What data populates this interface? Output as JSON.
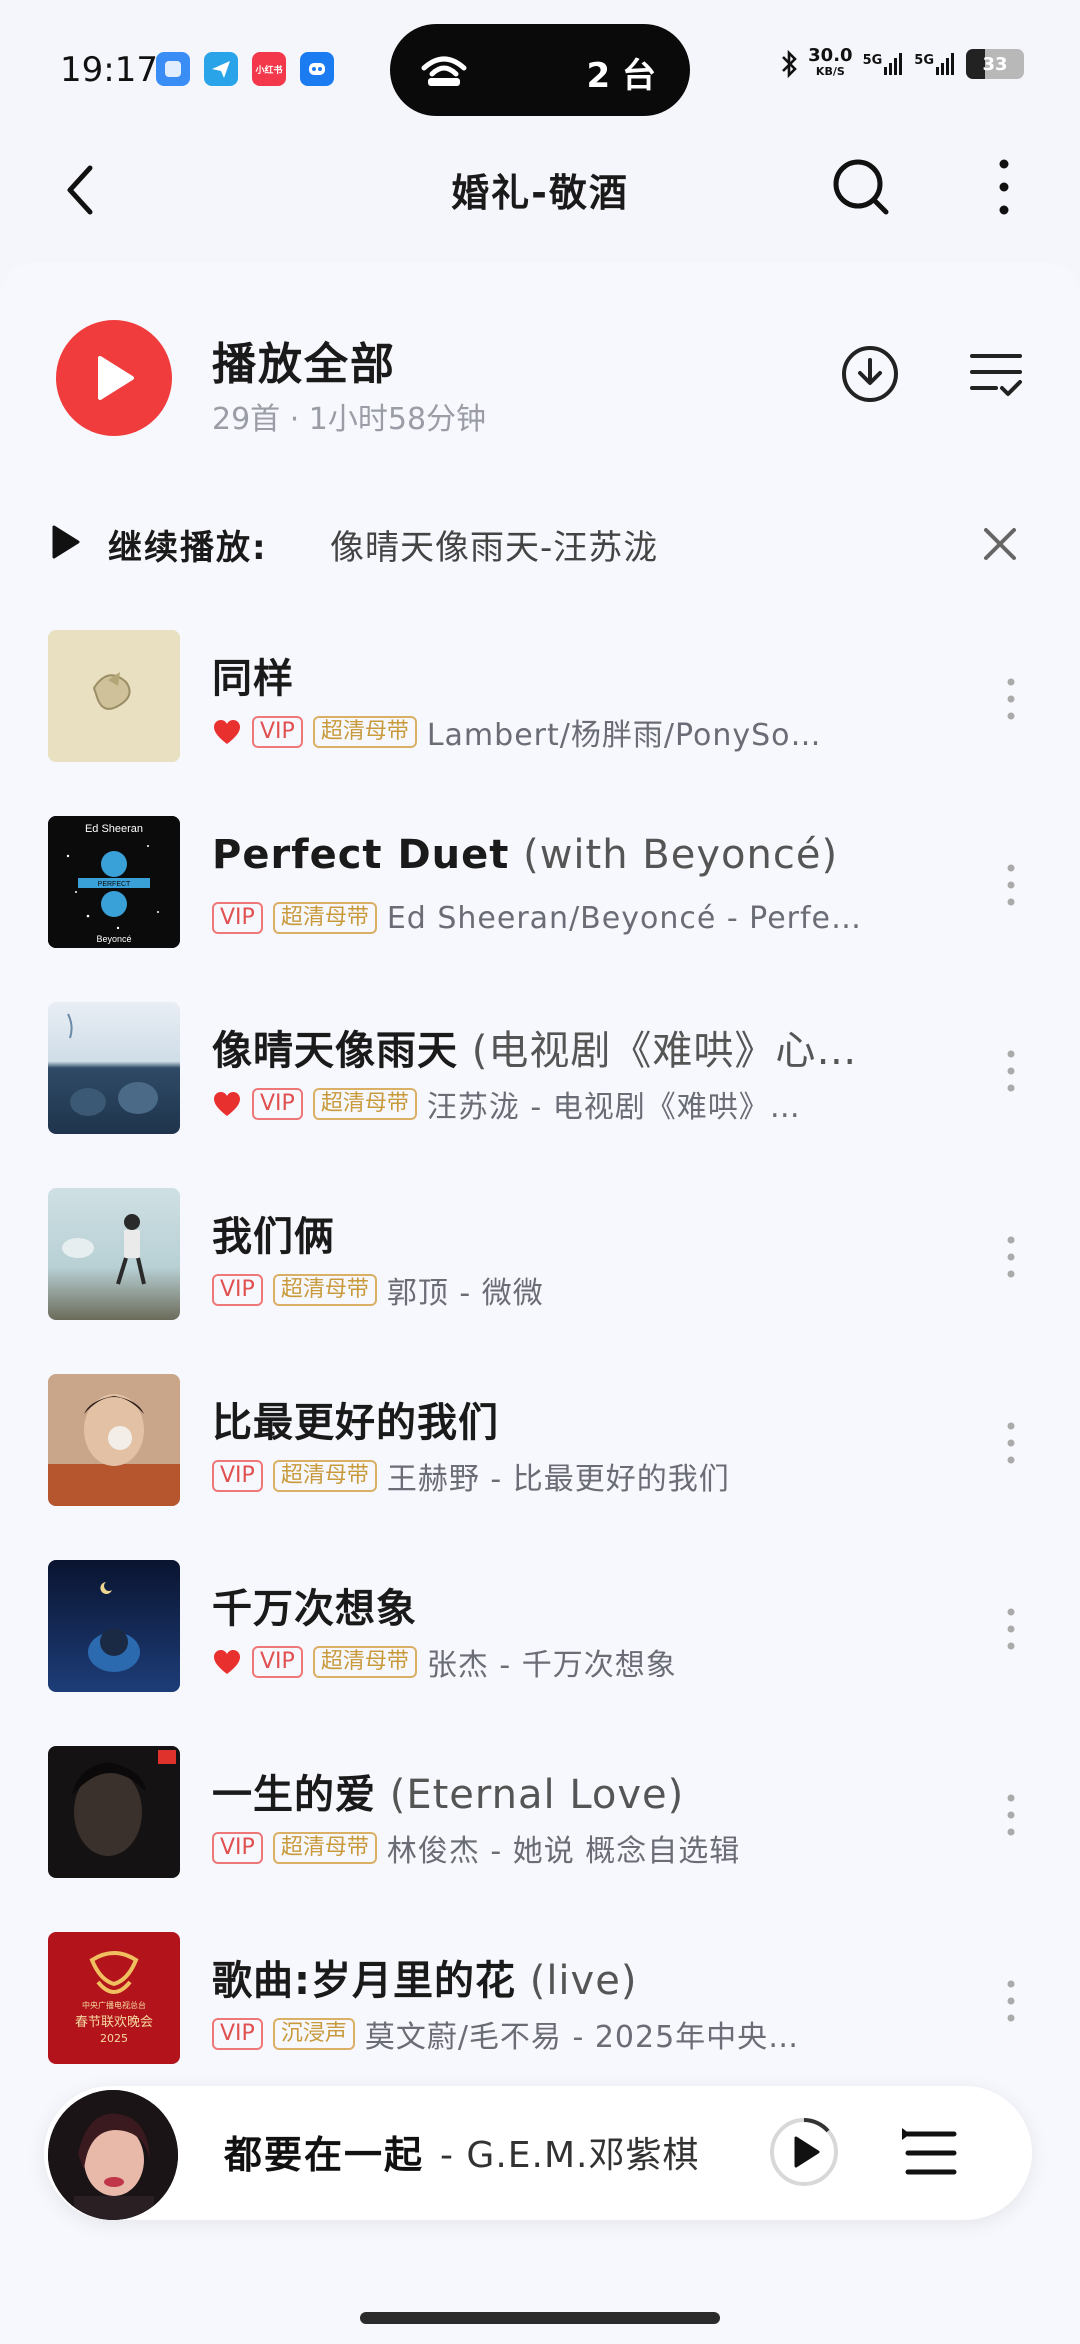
{
  "status_bar": {
    "time": "19:17",
    "island_text": "2 台",
    "net_speed_value": "30.0",
    "net_speed_unit": "KB/S",
    "signal1": "5G",
    "signal2": "5G",
    "battery": "33",
    "app_badge_text": "小红书"
  },
  "header": {
    "title": "婚礼-敬酒"
  },
  "play_all": {
    "label": "播放全部",
    "meta": "29首 · 1小时58分钟"
  },
  "resume": {
    "label": "继续播放:",
    "song": "像晴天像雨天-汪苏泷"
  },
  "songs": [
    {
      "title": "同样",
      "subtitle": "",
      "liked": true,
      "tags": [
        "VIP",
        "超清母带"
      ],
      "artist": "Lambert/杨胖雨/PonySo…"
    },
    {
      "title": "Perfect Duet",
      "subtitle": " (with Beyoncé)",
      "liked": false,
      "tags": [
        "VIP",
        "超清母带"
      ],
      "artist": "Ed Sheeran/Beyoncé - Perfe…"
    },
    {
      "title": "像晴天像雨天",
      "subtitle": " (电视剧《难哄》心…",
      "liked": true,
      "tags": [
        "VIP",
        "超清母带"
      ],
      "artist": "汪苏泷 - 电视剧《难哄》…"
    },
    {
      "title": "我们俩",
      "subtitle": "",
      "liked": false,
      "tags": [
        "VIP",
        "超清母带"
      ],
      "artist": "郭顶 - 微微"
    },
    {
      "title": "比最更好的我们",
      "subtitle": "",
      "liked": false,
      "tags": [
        "VIP",
        "超清母带"
      ],
      "artist": "王赫野 - 比最更好的我们"
    },
    {
      "title": "千万次想象",
      "subtitle": "",
      "liked": true,
      "tags": [
        "VIP",
        "超清母带"
      ],
      "artist": "张杰 - 千万次想象"
    },
    {
      "title": "一生的爱",
      "subtitle": " (Eternal Love)",
      "liked": false,
      "tags": [
        "VIP",
        "超清母带"
      ],
      "artist": "林俊杰 - 她说 概念自选辑"
    },
    {
      "title": "歌曲:岁月里的花",
      "subtitle": " (live)",
      "liked": false,
      "tags": [
        "VIP",
        "沉浸声"
      ],
      "artist": "莫文蔚/毛不易 - 2025年中央…"
    }
  ],
  "cover_texts": {
    "ed_top": "Ed Sheeran",
    "ed_mid": "PERFECT",
    "ed_bottom": "Beyoncé",
    "gala_line1": "中央广播电视总台",
    "gala_line2": "春节联欢晚会",
    "gala_year": "2025"
  },
  "mini_player": {
    "song": "都要在一起",
    "artist": "- G.E.M.邓紫棋"
  },
  "colors": {
    "accent_red": "#f03c3c",
    "vip": "#e05050",
    "hq": "#c89a3c"
  }
}
